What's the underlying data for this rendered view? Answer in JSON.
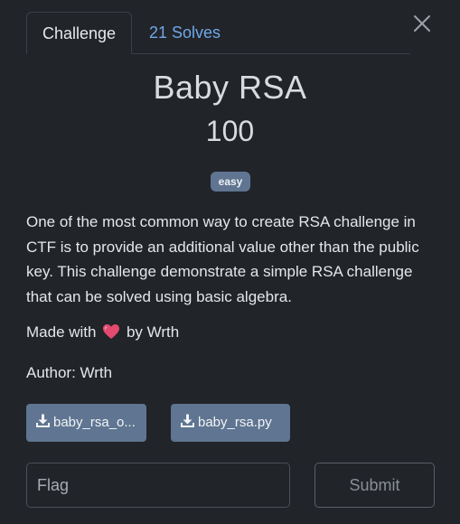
{
  "tabs": {
    "challenge_label": "Challenge",
    "solves_label": "21 Solves"
  },
  "challenge": {
    "name": "Baby RSA",
    "points": "100",
    "tag": "easy",
    "description": "One of the most common way to create RSA challenge in CTF is to provide an additional value other than the public key. This challenge demonstrate a simple RSA challenge that can be solved using basic algebra.",
    "made_prefix": "Made with",
    "made_suffix": "by Wrth",
    "author": "Author: Wrth"
  },
  "files": [
    {
      "label": "baby_rsa_o..."
    },
    {
      "label": "baby_rsa.py"
    }
  ],
  "submission": {
    "flag_placeholder": "Flag",
    "submit_label": "Submit"
  },
  "icons": {
    "close": "close-icon",
    "heart": "heart-icon",
    "download": "download-icon"
  },
  "colors": {
    "background": "#212429",
    "tag_bg": "#5f7591",
    "link": "#6fa8e8",
    "heart": "#e34a6f"
  }
}
